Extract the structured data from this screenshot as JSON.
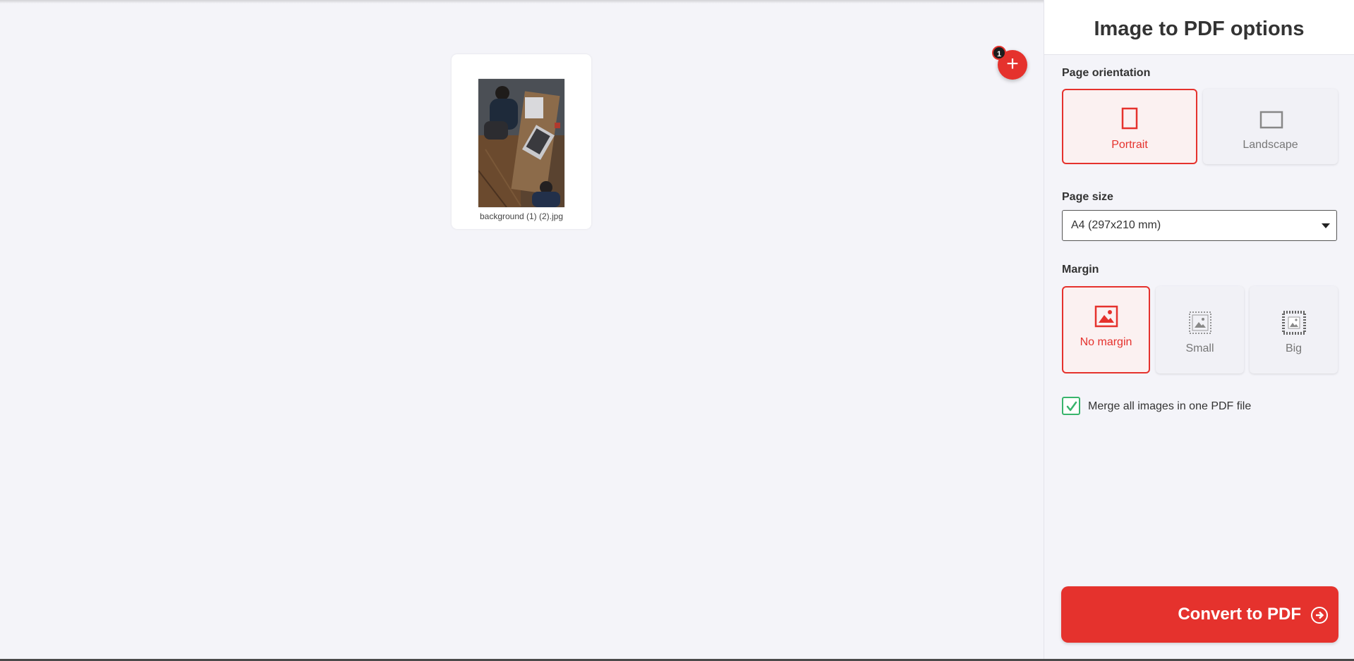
{
  "workspace": {
    "file": {
      "name": "background (1) (2).jpg"
    },
    "add_button": {
      "badge_count": "1",
      "icon": "plus-icon"
    }
  },
  "sidebar": {
    "title": "Image to PDF options",
    "orientation": {
      "label": "Page orientation",
      "options": [
        {
          "label": "Portrait",
          "selected": true,
          "icon": "portrait-icon"
        },
        {
          "label": "Landscape",
          "selected": false,
          "icon": "landscape-icon"
        }
      ]
    },
    "page_size": {
      "label": "Page size",
      "value": "A4 (297x210 mm)"
    },
    "margin": {
      "label": "Margin",
      "options": [
        {
          "label": "No margin",
          "selected": true,
          "icon": "no-margin-icon"
        },
        {
          "label": "Small",
          "selected": false,
          "icon": "small-margin-icon"
        },
        {
          "label": "Big",
          "selected": false,
          "icon": "big-margin-icon"
        }
      ]
    },
    "merge": {
      "label": "Merge all images in one PDF file",
      "checked": true
    },
    "convert_button": {
      "label": "Convert to PDF",
      "icon": "arrow-circle-right-icon"
    }
  },
  "colors": {
    "accent": "#e5322d",
    "background": "#f4f4f9",
    "checkbox": "#38b46c"
  }
}
